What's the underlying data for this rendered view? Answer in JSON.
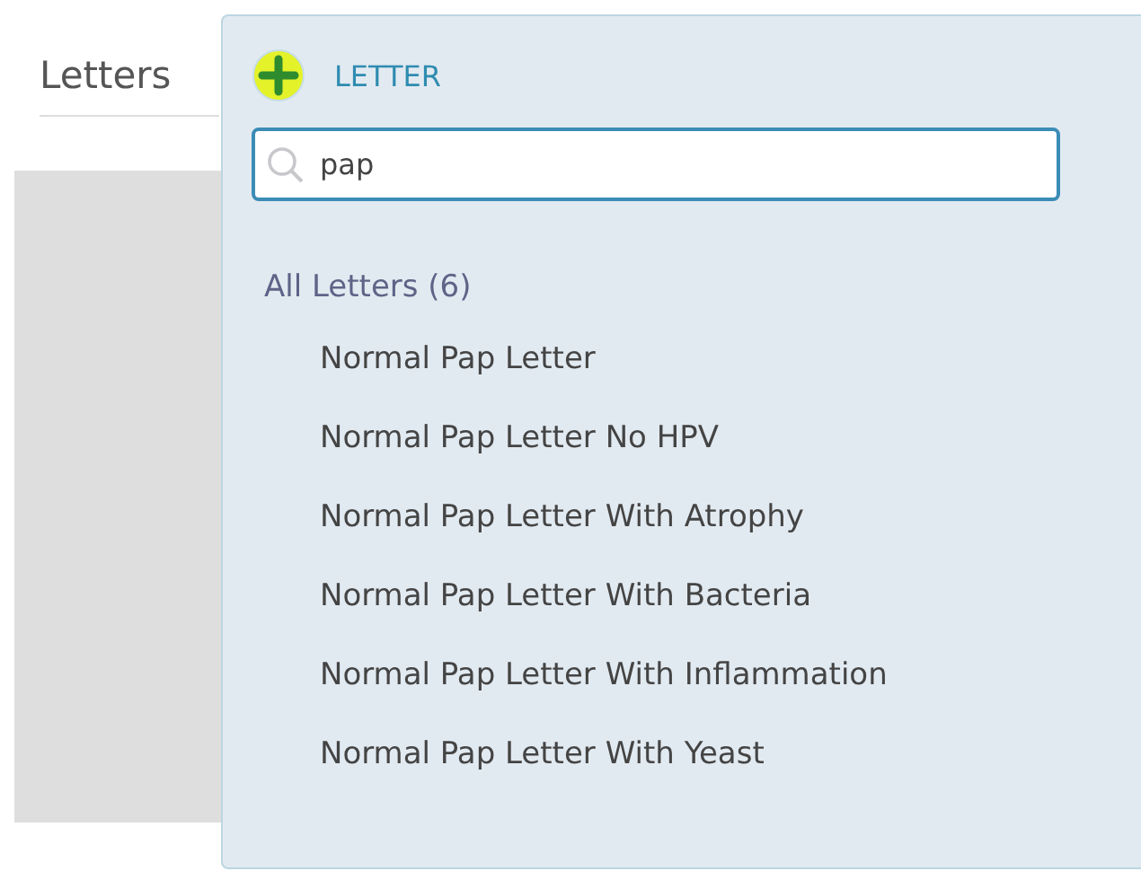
{
  "page": {
    "title": "Letters"
  },
  "popup": {
    "add_label": "LETTER",
    "search": {
      "value": "pap"
    },
    "group": {
      "label": "All Letters (6)",
      "items": [
        {
          "label": "Normal Pap Letter"
        },
        {
          "label": "Normal Pap Letter No HPV"
        },
        {
          "label": "Normal Pap Letter With Atrophy"
        },
        {
          "label": "Normal Pap Letter With Bacteria"
        },
        {
          "label": "Normal Pap Letter With Inflammation"
        },
        {
          "label": "Normal Pap Letter With Yeast"
        }
      ]
    }
  }
}
